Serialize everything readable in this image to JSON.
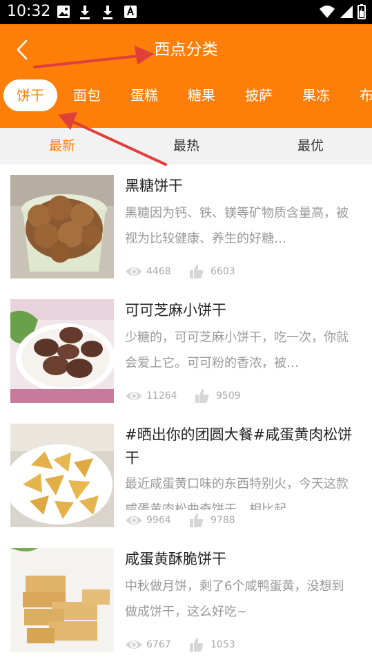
{
  "status_bar": {
    "time": "10:32",
    "left_icons": [
      "image-icon",
      "download-icon",
      "download-icon",
      "font-icon"
    ],
    "right_icons": [
      "wifi-icon",
      "signal-icon",
      "battery-icon"
    ]
  },
  "header": {
    "title": "西点分类",
    "background": "#fe7e0a",
    "back_icon": "chevron-left-icon"
  },
  "categories": {
    "active_index": 0,
    "items": [
      {
        "label": "饼干"
      },
      {
        "label": "面包"
      },
      {
        "label": "蛋糕"
      },
      {
        "label": "糖果"
      },
      {
        "label": "披萨"
      },
      {
        "label": "果冻"
      },
      {
        "label": "布"
      }
    ]
  },
  "sort_tabs": {
    "active_index": 0,
    "items": [
      {
        "label": "最新"
      },
      {
        "label": "最热"
      },
      {
        "label": "最优"
      }
    ]
  },
  "recipes": [
    {
      "title": "黑糖饼干",
      "description": "黑糖因为钙、铁、镁等矿物质含量高，被视为比较健康、养生的好糖…",
      "views": "4468",
      "likes": "6603"
    },
    {
      "title": "可可芝麻小饼干",
      "description": "少糖的，可可芝麻小饼干，吃一次，你就会爱上它。可可粉的香浓，被…",
      "views": "11264",
      "likes": "9509"
    },
    {
      "title": "#晒出你的团圆大餐#咸蛋黄肉松饼干",
      "description": "最近咸蛋黄口味的东西特别火，今天这款咸蛋黄肉松曲奇饼干，相比起",
      "views": "9964",
      "likes": "9788"
    },
    {
      "title": "咸蛋黄酥脆饼干",
      "description": "中秋做月饼，剩了6个咸鸭蛋黄，没想到做成饼干，这么好吃~",
      "views": "6767",
      "likes": "1053"
    }
  ],
  "stat_icons": {
    "views": "eye-icon",
    "likes": "thumbs-up-icon"
  },
  "annotation_color": "#e0403a"
}
